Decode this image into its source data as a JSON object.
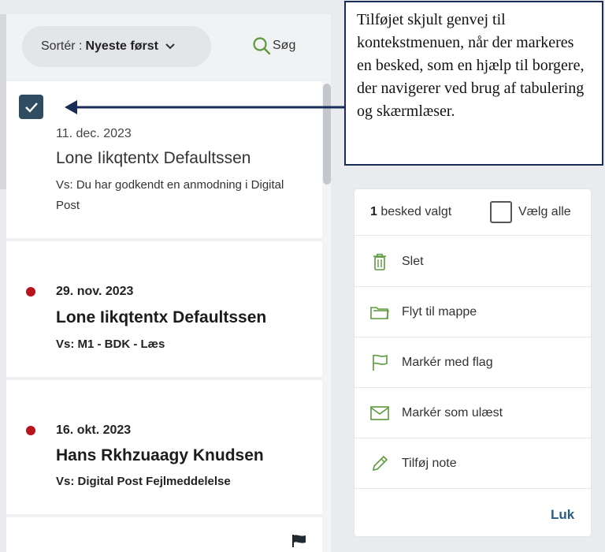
{
  "toolbar": {
    "sort_label": "Sortér :",
    "sort_value": "Nyeste først",
    "search_label": "Søg"
  },
  "messages": [
    {
      "date": "11. dec. 2023",
      "sender": "Lone Iikqtentx Defaultssen",
      "subject": "Vs: Du har godkendt en anmodning i Digital Post",
      "selected": true,
      "unread": false
    },
    {
      "date": "29. nov. 2023",
      "sender": "Lone Iikqtentx Defaultssen",
      "subject": "Vs: M1 - BDK - Læs",
      "selected": false,
      "unread": true
    },
    {
      "date": "16. okt. 2023",
      "sender": "Hans Rkhzuaagy Knudsen",
      "subject": "Vs: Digital Post Fejlmeddelelse",
      "selected": false,
      "unread": true
    }
  ],
  "callout": {
    "text": "Tilføjet skjult genvej til kontekstmenuen, når der markeres en besked, som en hjælp til borgere, der navigerer ved brug af tabulering og skærmlæser."
  },
  "context_menu": {
    "selected_count": "1",
    "selected_label": "besked valgt",
    "select_all_label": "Vælg alle",
    "items": [
      {
        "label": "Slet",
        "icon": "trash-icon"
      },
      {
        "label": "Flyt til mappe",
        "icon": "folder-icon"
      },
      {
        "label": "Markér med flag",
        "icon": "flag-icon"
      },
      {
        "label": "Markér som ulæst",
        "icon": "envelope-icon"
      },
      {
        "label": "Tilføj note",
        "icon": "pencil-icon"
      }
    ],
    "close_label": "Luk"
  },
  "colors": {
    "accent_green": "#5b9a3c",
    "checkbox_navy": "#2f4c61",
    "unread_dot": "#b8121b",
    "link_blue": "#2a5c86",
    "callout_border": "#1a2d57"
  }
}
